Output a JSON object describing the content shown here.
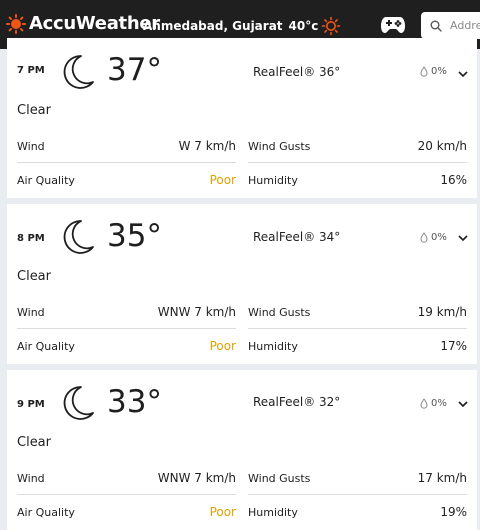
{
  "header": {
    "brand": "AccuWeather",
    "location": "Ahmedabad, Gujarat",
    "current_temp": "40°c",
    "search_placeholder": "Address"
  },
  "colors": {
    "brand_orange": "#f05514",
    "poor": "#e0a100",
    "header_bg": "#1f1f1f"
  },
  "icons": {
    "logo": "sun-icon",
    "weather": "moon-icon",
    "precip": "raindrop-icon",
    "expand": "chevron-down-icon",
    "games": "gamepad-icon",
    "search": "search-icon"
  },
  "hours": [
    {
      "time": "7 PM",
      "temp": "37°",
      "realfeel": "RealFeel® 36°",
      "precip": "0%",
      "phrase": "Clear",
      "wind_label": "Wind",
      "wind": "W 7 km/h",
      "gusts_label": "Wind Gusts",
      "gusts": "20 km/h",
      "aq_label": "Air Quality",
      "aq": "Poor",
      "humidity_label": "Humidity",
      "humidity": "16%"
    },
    {
      "time": "8 PM",
      "temp": "35°",
      "realfeel": "RealFeel® 34°",
      "precip": "0%",
      "phrase": "Clear",
      "wind_label": "Wind",
      "wind": "WNW 7 km/h",
      "gusts_label": "Wind Gusts",
      "gusts": "19 km/h",
      "aq_label": "Air Quality",
      "aq": "Poor",
      "humidity_label": "Humidity",
      "humidity": "17%"
    },
    {
      "time": "9 PM",
      "temp": "33°",
      "realfeel": "RealFeel® 32°",
      "precip": "0%",
      "phrase": "Clear",
      "wind_label": "Wind",
      "wind": "WNW 7 km/h",
      "gusts_label": "Wind Gusts",
      "gusts": "17 km/h",
      "aq_label": "Air Quality",
      "aq": "Poor",
      "humidity_label": "Humidity",
      "humidity": "19%"
    }
  ]
}
